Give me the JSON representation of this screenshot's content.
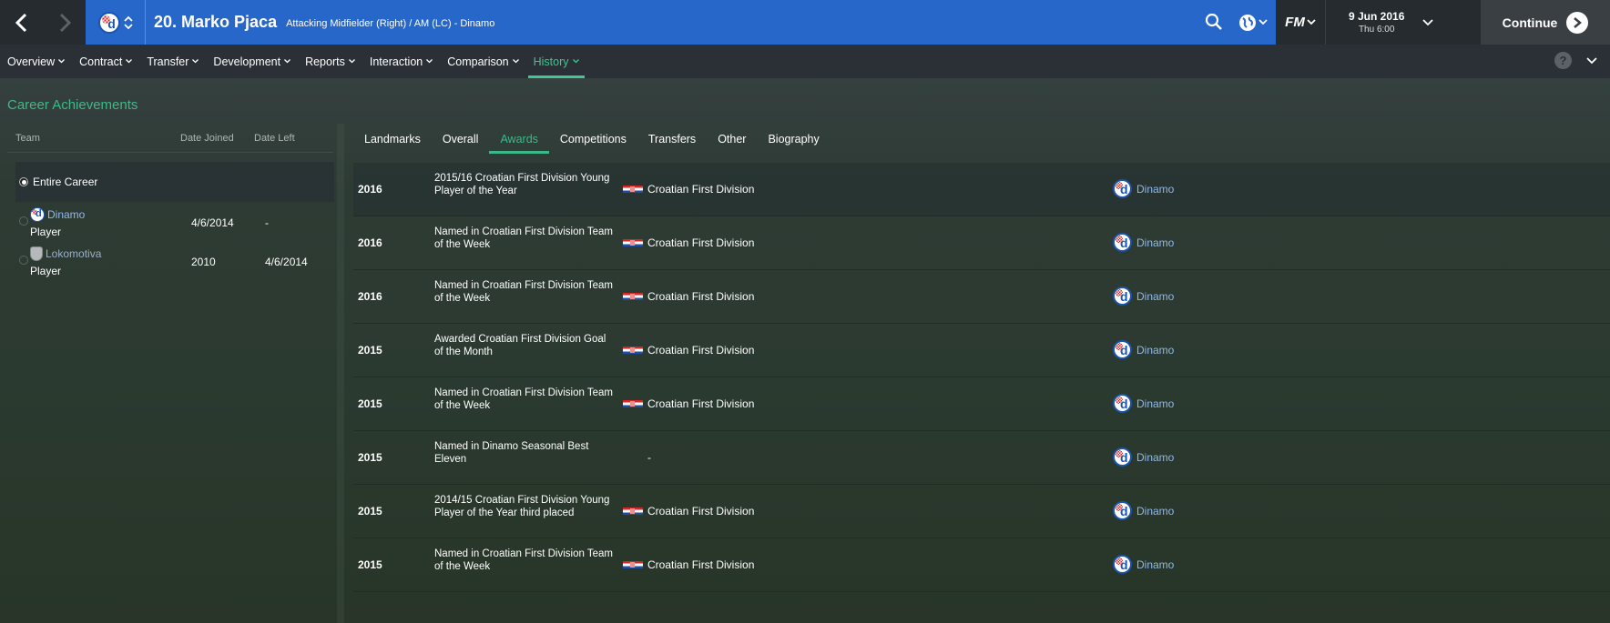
{
  "header": {
    "player_name": "20. Marko Pjaca",
    "player_subtitle": "Attacking Midfielder (Right) / AM (LC) - Dinamo",
    "fm_label": "FM",
    "date": "9 Jun 2016",
    "time": "Thu 6:00",
    "continue_label": "Continue",
    "badge_letter": "d",
    "accent_color": "#2767c9"
  },
  "menu": {
    "items": [
      {
        "label": "Overview"
      },
      {
        "label": "Contract"
      },
      {
        "label": "Transfer"
      },
      {
        "label": "Development"
      },
      {
        "label": "Reports"
      },
      {
        "label": "Interaction"
      },
      {
        "label": "Comparison"
      },
      {
        "label": "History"
      }
    ],
    "active": "History",
    "help_label": "?"
  },
  "section_title": "Career Achievements",
  "career": {
    "headers": {
      "team": "Team",
      "joined": "Date Joined",
      "left": "Date Left"
    },
    "entire_label": "Entire Career",
    "clubs": [
      {
        "name": "Dinamo",
        "role": "Player",
        "joined": "4/6/2014",
        "left": "-"
      },
      {
        "name": "Lokomotiva",
        "role": "Player",
        "joined": "2010",
        "left": "4/6/2014"
      }
    ]
  },
  "tabs": [
    {
      "label": "Landmarks"
    },
    {
      "label": "Overall"
    },
    {
      "label": "Awards"
    },
    {
      "label": "Competitions"
    },
    {
      "label": "Transfers"
    },
    {
      "label": "Other"
    },
    {
      "label": "Biography"
    }
  ],
  "active_tab": "Awards",
  "awards": [
    {
      "year": "2016",
      "award": "2015/16 Croatian First Division Young Player of the Year",
      "competition": "Croatian First Division",
      "club": "Dinamo"
    },
    {
      "year": "2016",
      "award": "Named in Croatian First Division Team of the Week",
      "competition": "Croatian First Division",
      "club": "Dinamo"
    },
    {
      "year": "2016",
      "award": "Named in Croatian First Division Team of the Week",
      "competition": "Croatian First Division",
      "club": "Dinamo"
    },
    {
      "year": "2015",
      "award": "Awarded Croatian First Division Goal of the Month",
      "competition": "Croatian First Division",
      "club": "Dinamo"
    },
    {
      "year": "2015",
      "award": "Named in Croatian First Division Team of the Week",
      "competition": "Croatian First Division",
      "club": "Dinamo"
    },
    {
      "year": "2015",
      "award": "Named in Dinamo Seasonal Best Eleven",
      "competition": "-",
      "club": "Dinamo"
    },
    {
      "year": "2015",
      "award": "2014/15 Croatian First Division Young Player of the Year third placed",
      "competition": "Croatian First Division",
      "club": "Dinamo"
    },
    {
      "year": "2015",
      "award": "Named in Croatian First Division Team of the Week",
      "competition": "Croatian First Division",
      "club": "Dinamo"
    }
  ]
}
